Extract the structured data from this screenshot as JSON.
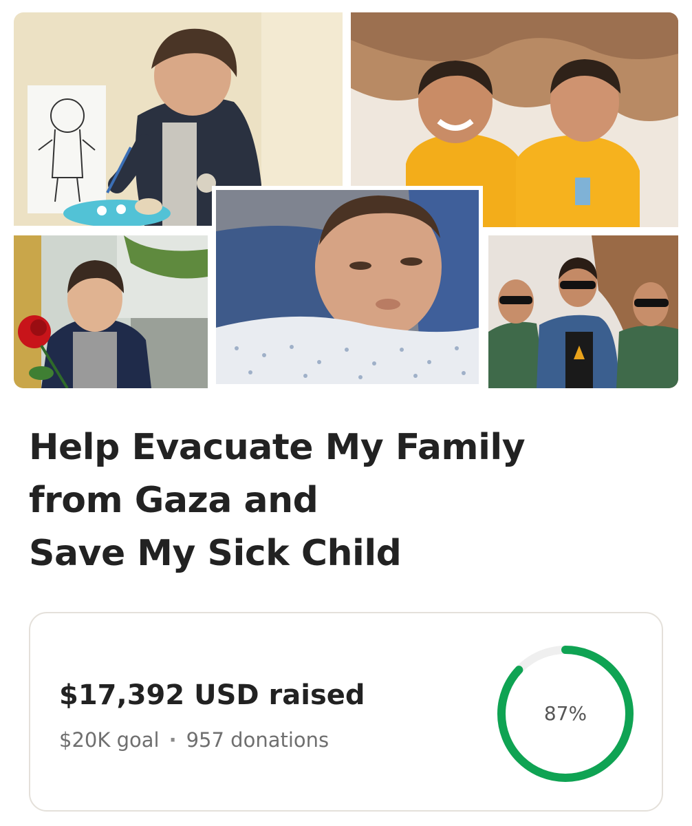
{
  "campaign": {
    "title_lines": [
      "Help Evacuate My Family",
      "from Gaza and",
      "Save My Sick Child"
    ],
    "raised_text": "$17,392 USD raised",
    "goal_text": "$20K goal",
    "separator": "·",
    "donations_text": "957 donations",
    "progress": {
      "percent": 87,
      "label": "87%",
      "color": "#0fa353",
      "track_color": "#efefef"
    }
  },
  "photos": [
    {
      "name": "child-painting-photo"
    },
    {
      "name": "twins-yellow-shirts-photo"
    },
    {
      "name": "child-with-rose-photo"
    },
    {
      "name": "child-hospital-bed-photo"
    },
    {
      "name": "three-children-sunglasses-photo"
    }
  ]
}
